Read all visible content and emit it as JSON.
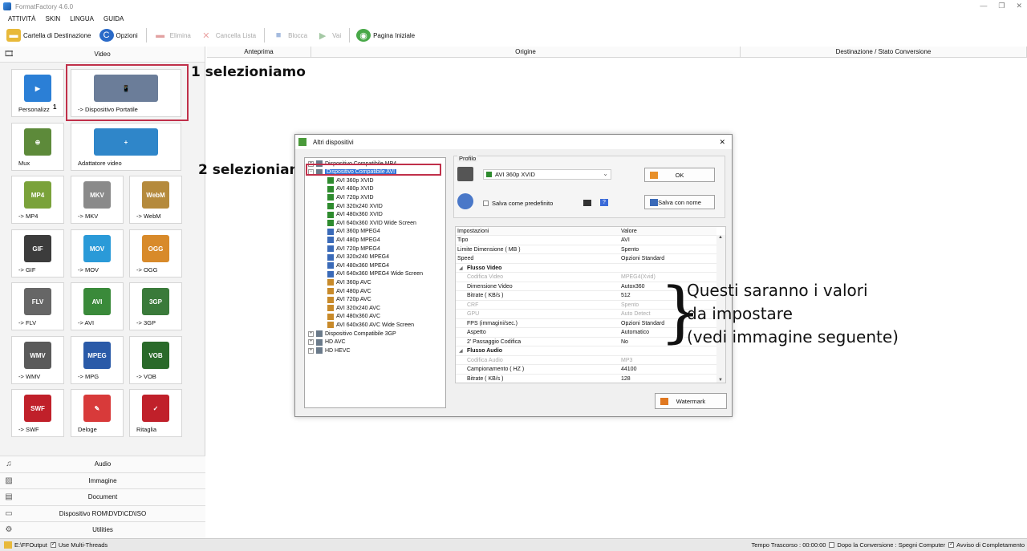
{
  "window": {
    "title": "FormatFactory 4.6.0",
    "minimize": "—",
    "restore": "❐",
    "close": "✕"
  },
  "menu": [
    "ATTIVITÀ",
    "SKIN",
    "LINGUA",
    "GUIDA"
  ],
  "toolbar": {
    "dest_folder": "Cartella di Destinazione",
    "options": "Opzioni",
    "remove": "Elimina",
    "clear_list": "Cancella Lista",
    "stop": "Blocca",
    "start": "Vai",
    "home_page": "Pagina Iniziale"
  },
  "left": {
    "video_header": "Video",
    "tiles": [
      {
        "label": "Personalizz",
        "badge": "1",
        "icon_text": "▶",
        "color": "#2b7fd6"
      },
      {
        "label": "-> Dispositivo Portatile",
        "icon_text": "📱",
        "color": "#6b7d99"
      },
      {
        "label": "Mux",
        "icon_text": "⊕",
        "color": "#5d8a3a"
      },
      {
        "label": "Adattatore video",
        "icon_text": "+",
        "color": "#2f86c9"
      },
      {
        "label": "-> MP4",
        "icon_text": "MP4",
        "color": "#7aa23a"
      },
      {
        "label": "-> MKV",
        "icon_text": "MKV",
        "color": "#8a8a8a"
      },
      {
        "label": "-> WebM",
        "icon_text": "WebM",
        "color": "#b58a3c"
      },
      {
        "label": "-> GIF",
        "icon_text": "GIF",
        "color": "#3c3c3c"
      },
      {
        "label": "-> MOV",
        "icon_text": "MOV",
        "color": "#2a9ad8"
      },
      {
        "label": "-> OGG",
        "icon_text": "OGG",
        "color": "#d88a2a"
      },
      {
        "label": "-> FLV",
        "icon_text": "FLV",
        "color": "#666666"
      },
      {
        "label": "-> AVI",
        "icon_text": "AVI",
        "color": "#3a8a3a"
      },
      {
        "label": "-> 3GP",
        "icon_text": "3GP",
        "color": "#3a7a3a"
      },
      {
        "label": "-> WMV",
        "icon_text": "WMV",
        "color": "#5a5a5a"
      },
      {
        "label": "-> MPG",
        "icon_text": "MPEG",
        "color": "#2a5aa8"
      },
      {
        "label": "-> VOB",
        "icon_text": "VOB",
        "color": "#2a6a2a"
      },
      {
        "label": "-> SWF",
        "icon_text": "SWF",
        "color": "#c0202a"
      },
      {
        "label": "Deloge",
        "icon_text": "✎",
        "color": "#d83a3a"
      },
      {
        "label": "Ritaglia",
        "icon_text": "✓",
        "color": "#c0202a"
      }
    ],
    "categories": [
      "Audio",
      "Immagine",
      "Document",
      "Dispositivo ROM\\DVD\\CD\\ISO",
      "Utilities"
    ]
  },
  "list_header": {
    "preview": "Anteprima",
    "source": "Origine",
    "dest": "Destinazione / Stato Conversione"
  },
  "annotations": {
    "step1": "1 selezioniamo",
    "step2": "2 selezioniamo",
    "note_line1": "Questi saranno i valori",
    "note_line2": "da impostare",
    "note_line3": "(vedi immagine seguente)",
    "brace": "}"
  },
  "dialog": {
    "title": "Altri dispositivi",
    "close": "✕",
    "tree": [
      {
        "label": "Dispositivo Compatibile MP4",
        "level": 0,
        "expander": "+"
      },
      {
        "label": "Dispositivo Compatibile AVI",
        "level": 0,
        "expander": "−",
        "selected": true
      },
      {
        "label": "AVI 360p XVID",
        "level": 1
      },
      {
        "label": "AVI 480p XVID",
        "level": 1
      },
      {
        "label": "AVI 720p XVID",
        "level": 1
      },
      {
        "label": "AVI 320x240 XVID",
        "level": 1
      },
      {
        "label": "AVI 480x360 XVID",
        "level": 1
      },
      {
        "label": "AVI 640x360 XVID Wide Screen",
        "level": 1
      },
      {
        "label": "AVI 360p MPEG4",
        "level": 1
      },
      {
        "label": "AVI 480p MPEG4",
        "level": 1
      },
      {
        "label": "AVI 720p MPEG4",
        "level": 1
      },
      {
        "label": "AVI 320x240 MPEG4",
        "level": 1
      },
      {
        "label": "AVI 480x360 MPEG4",
        "level": 1
      },
      {
        "label": "AVI 640x360 MPEG4 Wide Screen",
        "level": 1
      },
      {
        "label": "AVI 360p AVC",
        "level": 1
      },
      {
        "label": "AVI 480p AVC",
        "level": 1
      },
      {
        "label": "AVI 720p AVC",
        "level": 1
      },
      {
        "label": "AVI 320x240 AVC",
        "level": 1
      },
      {
        "label": "AVI 480x360 AVC",
        "level": 1
      },
      {
        "label": "AVI 640x360 AVC Wide Screen",
        "level": 1
      },
      {
        "label": "Dispositivo Compatibile 3GP",
        "level": 0,
        "expander": "+"
      },
      {
        "label": "HD AVC",
        "level": 0,
        "expander": "+"
      },
      {
        "label": "HD HEVC",
        "level": 0,
        "expander": "+"
      }
    ],
    "profile_legend": "Profilo",
    "profile_value": "AVI 360p XVID",
    "ok": "OK",
    "save_default": "Salva come predefinito",
    "save_as": "Salva con nome",
    "settings_header": {
      "key": "Impostazioni",
      "value": "Valore"
    },
    "settings": [
      {
        "key": "Tipo",
        "value": "AVI",
        "kind": "row"
      },
      {
        "key": "Limite Dimensione ( MB )",
        "value": "Spento",
        "kind": "row"
      },
      {
        "key": "Speed",
        "value": "Opzioni Standard",
        "kind": "row"
      },
      {
        "key": "Flusso Video",
        "value": "",
        "kind": "group"
      },
      {
        "key": "Codifica Video",
        "value": "MPEG4(Xvid)",
        "kind": "sub",
        "dim": true
      },
      {
        "key": "Dimensione Video",
        "value": "Autox360",
        "kind": "sub"
      },
      {
        "key": "Bitrate ( KB/s )",
        "value": "512",
        "kind": "sub"
      },
      {
        "key": "CRF",
        "value": "Spento",
        "kind": "sub",
        "dim": true
      },
      {
        "key": "GPU",
        "value": "Auto Detect",
        "kind": "sub",
        "dim": true
      },
      {
        "key": "FPS (immagini/sec.)",
        "value": "Opzioni Standard",
        "kind": "sub"
      },
      {
        "key": "Aspetto",
        "value": "Automatico",
        "kind": "sub"
      },
      {
        "key": "2' Passaggio Codifica",
        "value": "No",
        "kind": "sub"
      },
      {
        "key": "Flusso Audio",
        "value": "",
        "kind": "group"
      },
      {
        "key": "Codifica Audio",
        "value": "MP3",
        "kind": "sub",
        "dim": true
      },
      {
        "key": "Campionamento ( HZ )",
        "value": "44100",
        "kind": "sub"
      },
      {
        "key": "Bitrate ( KB/s )",
        "value": "128",
        "kind": "sub"
      }
    ],
    "watermark": "Watermark"
  },
  "status": {
    "output_path": "E:\\FFOutput",
    "multithread": "Use Multi-Threads",
    "elapsed_label": "Tempo Trascorso : 00:00:00",
    "after_conversion": "Dopo la Conversione : Spegni Computer",
    "completion_notice": "Avviso di Completamento"
  },
  "colors": {
    "highlight": "#c0304a",
    "selection": "#3375d8"
  }
}
